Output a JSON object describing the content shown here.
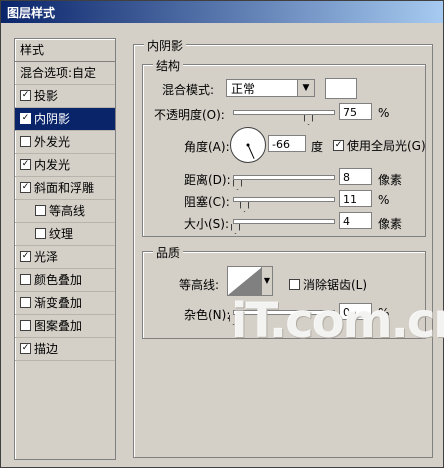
{
  "window": {
    "title": "图层样式"
  },
  "styles": {
    "header": "样式",
    "blend_options": "混合选项:自定",
    "items": [
      {
        "label": "投影",
        "checked": true,
        "selected": false,
        "sub": false
      },
      {
        "label": "内阴影",
        "checked": true,
        "selected": true,
        "sub": false
      },
      {
        "label": "外发光",
        "checked": false,
        "selected": false,
        "sub": false
      },
      {
        "label": "内发光",
        "checked": true,
        "selected": false,
        "sub": false
      },
      {
        "label": "斜面和浮雕",
        "checked": true,
        "selected": false,
        "sub": false
      },
      {
        "label": "等高线",
        "checked": false,
        "selected": false,
        "sub": true
      },
      {
        "label": "纹理",
        "checked": false,
        "selected": false,
        "sub": true
      },
      {
        "label": "光泽",
        "checked": true,
        "selected": false,
        "sub": false
      },
      {
        "label": "颜色叠加",
        "checked": false,
        "selected": false,
        "sub": false
      },
      {
        "label": "渐变叠加",
        "checked": false,
        "selected": false,
        "sub": false
      },
      {
        "label": "图案叠加",
        "checked": false,
        "selected": false,
        "sub": false
      },
      {
        "label": "描边",
        "checked": true,
        "selected": false,
        "sub": false
      }
    ]
  },
  "inner_shadow": {
    "group_title": "内阴影",
    "structure": {
      "title": "结构",
      "blend_mode_label": "混合模式:",
      "blend_mode_value": "正常",
      "opacity_label": "不透明度(O):",
      "opacity_value": "75",
      "opacity_unit": "%",
      "angle_label": "角度(A):",
      "angle_value": "-66",
      "angle_unit": "度",
      "global_light_label": "使用全局光(G)",
      "global_light_checked": true,
      "distance_label": "距离(D):",
      "distance_value": "8",
      "distance_unit": "像素",
      "choke_label": "阻塞(C):",
      "choke_value": "11",
      "choke_unit": "%",
      "size_label": "大小(S):",
      "size_value": "4",
      "size_unit": "像素"
    },
    "quality": {
      "title": "品质",
      "contour_label": "等高线:",
      "anti_alias_label": "消除锯齿(L)",
      "anti_alias_checked": false,
      "noise_label": "杂色(N):",
      "noise_value": "0",
      "noise_unit": "%"
    }
  },
  "levels": {
    "opacity": 0.75,
    "distance": 0.04,
    "choke": 0.11,
    "size": 0.02,
    "noise": 0.0
  },
  "watermark": "iT.com.cn",
  "colors": {
    "selection": "#0a246a",
    "panel": "#d4d0c8",
    "border": "#808080"
  }
}
